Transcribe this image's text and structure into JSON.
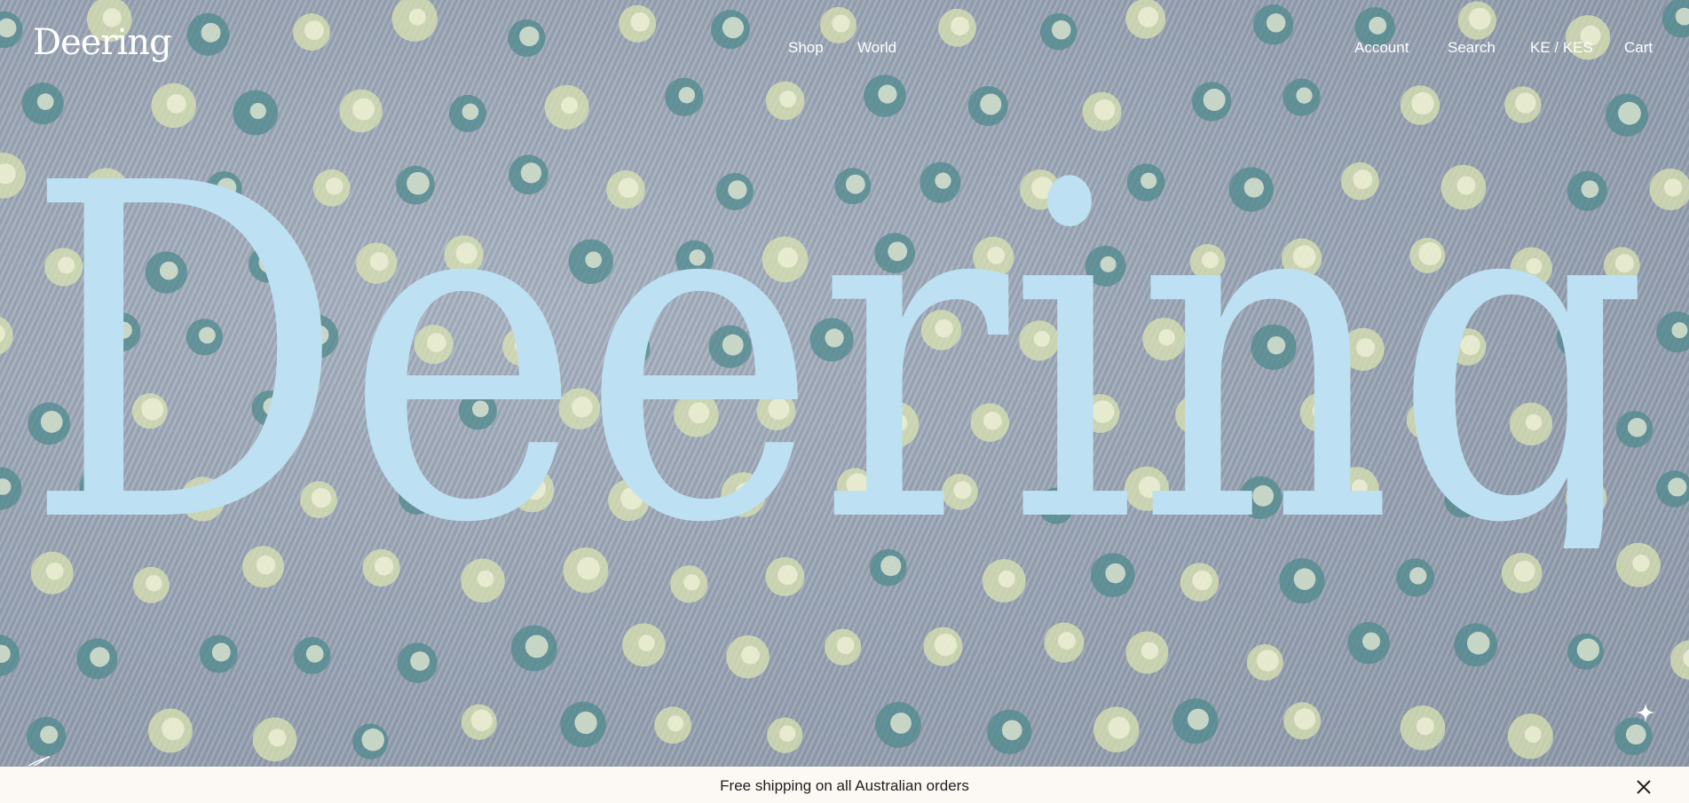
{
  "header": {
    "logo": "Deering",
    "nav": {
      "shop": "Shop",
      "world": "World"
    },
    "utility": {
      "account": "Account",
      "search": "Search",
      "locale": "KE / KES",
      "cart": "Cart"
    }
  },
  "hero": {
    "wordmark": "Deering",
    "wordmark_color": "#bde0f2",
    "sparkle_icon": "sparkle-icon"
  },
  "announcement": {
    "text": "Free shipping on all Australian orders",
    "close_icon": "close-icon"
  }
}
